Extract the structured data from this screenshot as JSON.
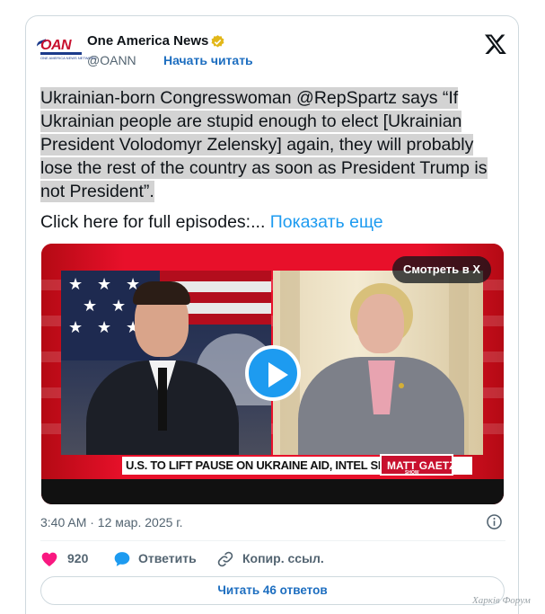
{
  "account": {
    "name": "One America News",
    "handle": "@OANN",
    "follow_label": "Начать читать",
    "logo_text": "OAN",
    "logo_subtext": "ONE AMERICA NEWS NETWORK",
    "verified_icon": "verified-badge-gold"
  },
  "tweet": {
    "text": "Ukrainian-born Congresswoman @RepSpartz says “If Ukrainian people are stupid enough to elect [Ukrainian President Volodomyr Zelensky] again, they will probably lose the rest of the country as soon as President Trump is not President”.",
    "more_prefix": "Click here for full episodes:... ",
    "show_more_label": "Показать еще"
  },
  "media": {
    "watch_label": "Смотреть в X",
    "chyron": "U.S. TO LIFT PAUSE ON UKRAINE AID, INTEL SHARING",
    "show_name": "MATT GAETZ",
    "show_sub": "SHOW",
    "play_icon": "play-icon"
  },
  "meta": {
    "timestamp": "3:40 AM · 12 мар. 2025 г."
  },
  "actions": {
    "like_count": "920",
    "reply_label": "Ответить",
    "copy_label": "Копир. ссыл."
  },
  "replies_button": "Читать 46 ответов",
  "watermark": "Харків Форум",
  "colors": {
    "link": "#1d9bf0",
    "like": "#f91880",
    "accent_red": "#c8102e",
    "verified_gold": "#e2b719"
  }
}
